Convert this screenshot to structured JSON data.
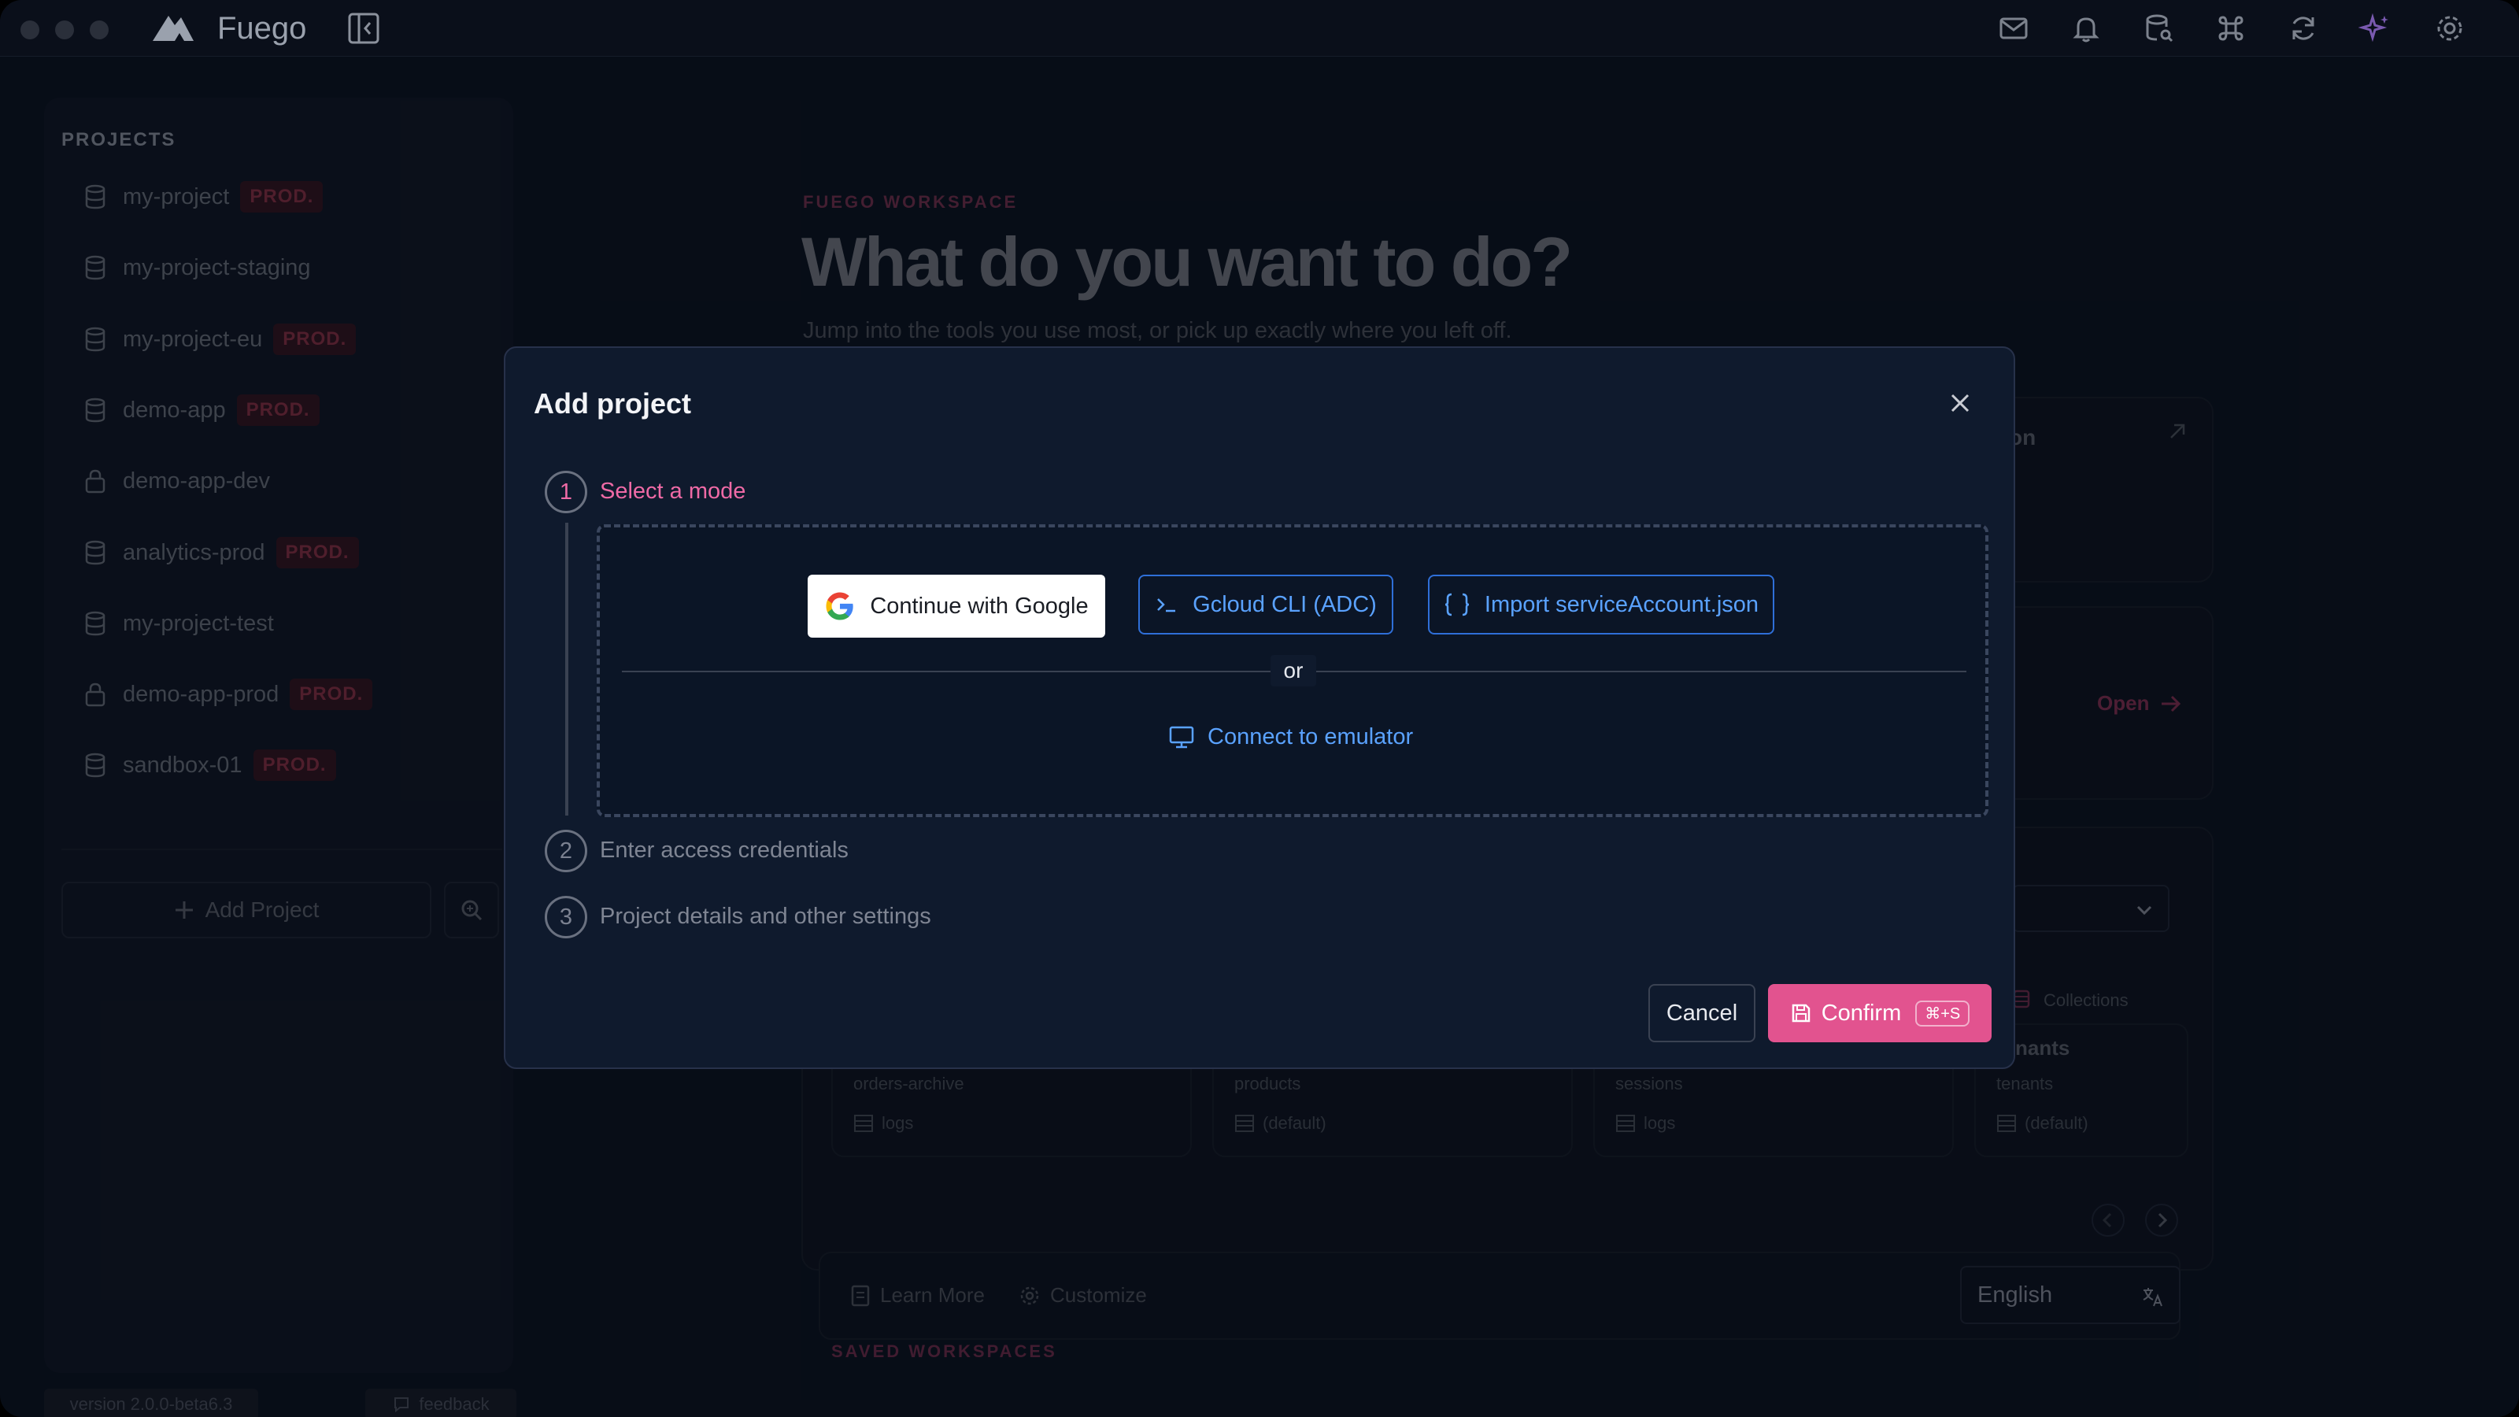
{
  "app": {
    "name": "Fuego"
  },
  "sidebar": {
    "heading": "PROJECTS",
    "projects": [
      {
        "name": "my-project",
        "badge": "PROD.",
        "icon": "database-icon"
      },
      {
        "name": "my-project-staging",
        "badge": "",
        "icon": "database-icon"
      },
      {
        "name": "my-project-eu",
        "badge": "PROD.",
        "icon": "database-icon"
      },
      {
        "name": "demo-app",
        "badge": "PROD.",
        "icon": "database-icon"
      },
      {
        "name": "demo-app-dev",
        "badge": "",
        "icon": "lock-icon"
      },
      {
        "name": "analytics-prod",
        "badge": "PROD.",
        "icon": "database-icon"
      },
      {
        "name": "my-project-test",
        "badge": "",
        "icon": "database-icon"
      },
      {
        "name": "demo-app-prod",
        "badge": "PROD.",
        "icon": "lock-icon"
      },
      {
        "name": "sandbox-01",
        "badge": "PROD.",
        "icon": "database-icon"
      }
    ],
    "add_project": "Add Project",
    "version": "version 2.0.0-beta6.3",
    "feedback": "feedback"
  },
  "workspace": {
    "eyebrow": "FUEGO WORKSPACE",
    "title": "What do you want to do?",
    "subtitle": "Jump into the tools you use most, or pick up exactly where you left off.",
    "card_fragment": "on",
    "open_label": "Open",
    "collections_label": "Collections",
    "collections_card_title": "nants",
    "collection_cards": [
      {
        "name": "orders-archive",
        "db": "logs"
      },
      {
        "name": "products",
        "db": "(default)"
      },
      {
        "name": "sessions",
        "db": "logs"
      },
      {
        "name": "tenants",
        "db": "(default)"
      }
    ],
    "learn_more": "Learn More",
    "customize": "Customize",
    "language": "English",
    "saved_workspaces": "SAVED WORKSPACES"
  },
  "modal": {
    "title": "Add project",
    "steps": [
      {
        "number": "1",
        "label": "Select a mode"
      },
      {
        "number": "2",
        "label": "Enter access credentials"
      },
      {
        "number": "3",
        "label": "Project details and other settings"
      }
    ],
    "google_button": "Continue with Google",
    "gcloud_button": "Gcloud CLI (ADC)",
    "import_button": "Import serviceAccount.json",
    "or": "or",
    "emulator": "Connect to emulator",
    "cancel": "Cancel",
    "confirm": "Confirm",
    "confirm_shortcut": "⌘+S"
  },
  "colors": {
    "accent": "#e2538f",
    "step_active": "#ef6aa6",
    "link_blue": "#5aa2ff",
    "button_border_blue": "#2f6fd8"
  }
}
